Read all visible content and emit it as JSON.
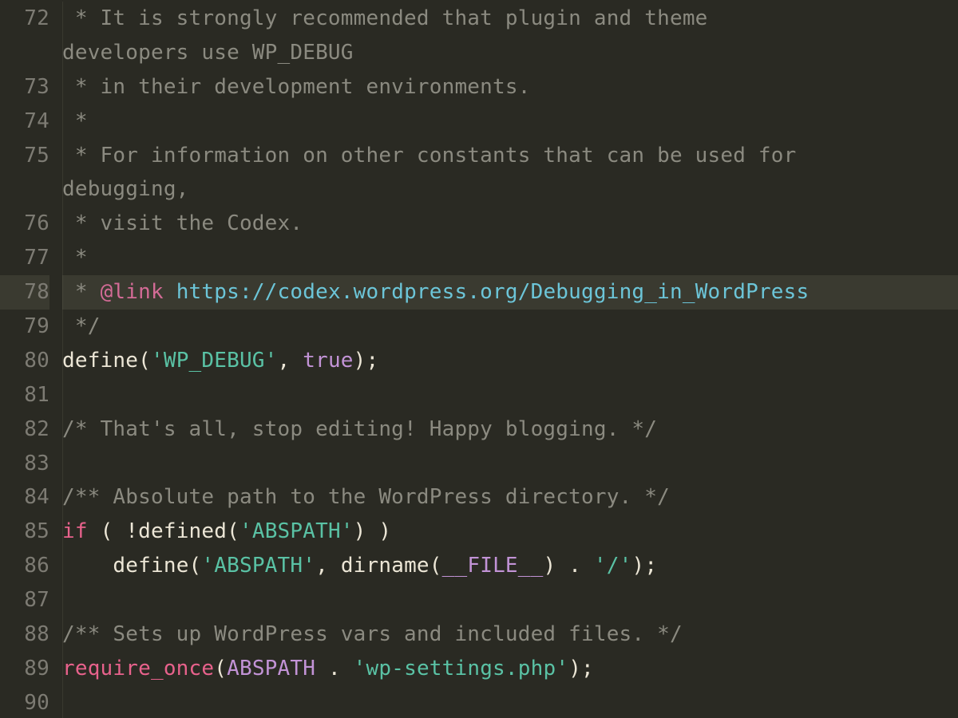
{
  "editor": {
    "highlighted_line": 78,
    "lines": [
      {
        "num": 72,
        "wrap": true,
        "tokens": [
          {
            "cls": "c",
            "t": " * It is strongly recommended that plugin and theme "
          }
        ],
        "wrap_tokens": [
          {
            "cls": "c",
            "t": "developers use WP_DEBUG"
          }
        ]
      },
      {
        "num": 73,
        "tokens": [
          {
            "cls": "c",
            "t": " * in their development environments."
          }
        ]
      },
      {
        "num": 74,
        "tokens": [
          {
            "cls": "c",
            "t": " *"
          }
        ]
      },
      {
        "num": 75,
        "wrap": true,
        "tokens": [
          {
            "cls": "c",
            "t": " * For information on other constants that can be used for "
          }
        ],
        "wrap_tokens": [
          {
            "cls": "c",
            "t": "debugging,"
          }
        ]
      },
      {
        "num": 76,
        "tokens": [
          {
            "cls": "c",
            "t": " * visit the Codex."
          }
        ]
      },
      {
        "num": 77,
        "tokens": [
          {
            "cls": "c",
            "t": " *"
          }
        ]
      },
      {
        "num": 78,
        "hl": true,
        "tokens": [
          {
            "cls": "c",
            "t": " * "
          },
          {
            "cls": "mag",
            "t": "@link"
          },
          {
            "cls": "c",
            "t": " "
          },
          {
            "cls": "u",
            "t": "https://codex.wordpress.org/Debugging_in_WordPress"
          }
        ]
      },
      {
        "num": 79,
        "tokens": [
          {
            "cls": "c",
            "t": " */"
          }
        ]
      },
      {
        "num": 80,
        "tokens": [
          {
            "cls": "fn",
            "t": "define"
          },
          {
            "cls": "d",
            "t": "("
          },
          {
            "cls": "s",
            "t": "'WP_DEBUG'"
          },
          {
            "cls": "d",
            "t": ", "
          },
          {
            "cls": "cn",
            "t": "true"
          },
          {
            "cls": "d",
            "t": ");"
          }
        ]
      },
      {
        "num": 81,
        "tokens": []
      },
      {
        "num": 82,
        "tokens": [
          {
            "cls": "c",
            "t": "/* That's all, stop editing! Happy blogging. */"
          }
        ]
      },
      {
        "num": 83,
        "tokens": []
      },
      {
        "num": 84,
        "tokens": [
          {
            "cls": "c",
            "t": "/** Absolute path to the WordPress directory. */"
          }
        ]
      },
      {
        "num": 85,
        "tokens": [
          {
            "cls": "k",
            "t": "if"
          },
          {
            "cls": "d",
            "t": " ( "
          },
          {
            "cls": "op",
            "t": "!"
          },
          {
            "cls": "fn",
            "t": "defined"
          },
          {
            "cls": "d",
            "t": "("
          },
          {
            "cls": "s",
            "t": "'ABSPATH'"
          },
          {
            "cls": "d",
            "t": ") )"
          }
        ]
      },
      {
        "num": 86,
        "tokens": [
          {
            "cls": "d",
            "t": "    "
          },
          {
            "cls": "fn",
            "t": "define"
          },
          {
            "cls": "d",
            "t": "("
          },
          {
            "cls": "s",
            "t": "'ABSPATH'"
          },
          {
            "cls": "d",
            "t": ", "
          },
          {
            "cls": "fn",
            "t": "dirname"
          },
          {
            "cls": "d",
            "t": "("
          },
          {
            "cls": "cn",
            "t": "__FILE__"
          },
          {
            "cls": "d",
            "t": ") "
          },
          {
            "cls": "op",
            "t": "."
          },
          {
            "cls": "d",
            "t": " "
          },
          {
            "cls": "s",
            "t": "'/'"
          },
          {
            "cls": "d",
            "t": ");"
          }
        ]
      },
      {
        "num": 87,
        "tokens": []
      },
      {
        "num": 88,
        "tokens": [
          {
            "cls": "c",
            "t": "/** Sets up WordPress vars and included files. */"
          }
        ]
      },
      {
        "num": 89,
        "tokens": [
          {
            "cls": "k",
            "t": "require_once"
          },
          {
            "cls": "d",
            "t": "("
          },
          {
            "cls": "cn",
            "t": "ABSPATH"
          },
          {
            "cls": "d",
            "t": " "
          },
          {
            "cls": "op",
            "t": "."
          },
          {
            "cls": "d",
            "t": " "
          },
          {
            "cls": "s",
            "t": "'wp-settings.php'"
          },
          {
            "cls": "d",
            "t": ");"
          }
        ]
      },
      {
        "num": 90,
        "tokens": []
      }
    ]
  }
}
